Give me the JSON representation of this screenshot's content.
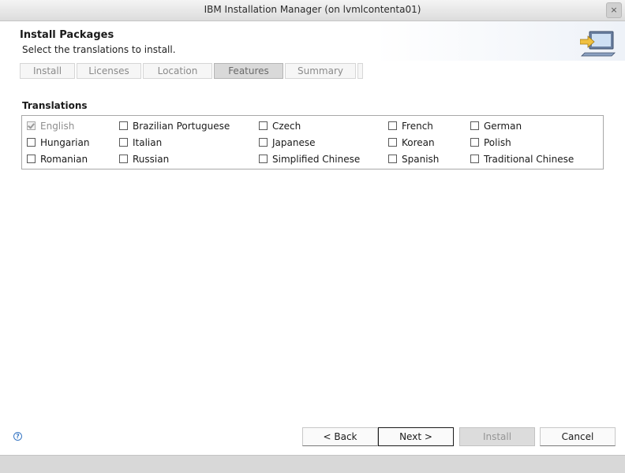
{
  "window": {
    "title": "IBM Installation Manager  (on lvmlcontenta01)",
    "close_label": "×"
  },
  "header": {
    "title": "Install Packages",
    "subtitle": "Select the translations to install.",
    "icon": "install-wizard-icon"
  },
  "steps": [
    {
      "label": "Install",
      "active": false
    },
    {
      "label": "Licenses",
      "active": false
    },
    {
      "label": "Location",
      "active": false
    },
    {
      "label": "Features",
      "active": true
    },
    {
      "label": "Summary",
      "active": false
    }
  ],
  "translations": {
    "title": "Translations",
    "options": [
      {
        "label": "English",
        "checked": true,
        "disabled": true
      },
      {
        "label": "Brazilian Portuguese",
        "checked": false
      },
      {
        "label": "Czech",
        "checked": false
      },
      {
        "label": "French",
        "checked": false
      },
      {
        "label": "German",
        "checked": false
      },
      {
        "label": "Hungarian",
        "checked": false
      },
      {
        "label": "Italian",
        "checked": false
      },
      {
        "label": "Japanese",
        "checked": false
      },
      {
        "label": "Korean",
        "checked": false
      },
      {
        "label": "Polish",
        "checked": false
      },
      {
        "label": "Romanian",
        "checked": false
      },
      {
        "label": "Russian",
        "checked": false
      },
      {
        "label": "Simplified Chinese",
        "checked": false
      },
      {
        "label": "Spanish",
        "checked": false
      },
      {
        "label": "Traditional Chinese",
        "checked": false
      }
    ]
  },
  "buttons": {
    "back": "< Back",
    "next": "Next >",
    "install": "Install",
    "cancel": "Cancel"
  },
  "help_icon": "help-icon",
  "help_glyph": "?"
}
